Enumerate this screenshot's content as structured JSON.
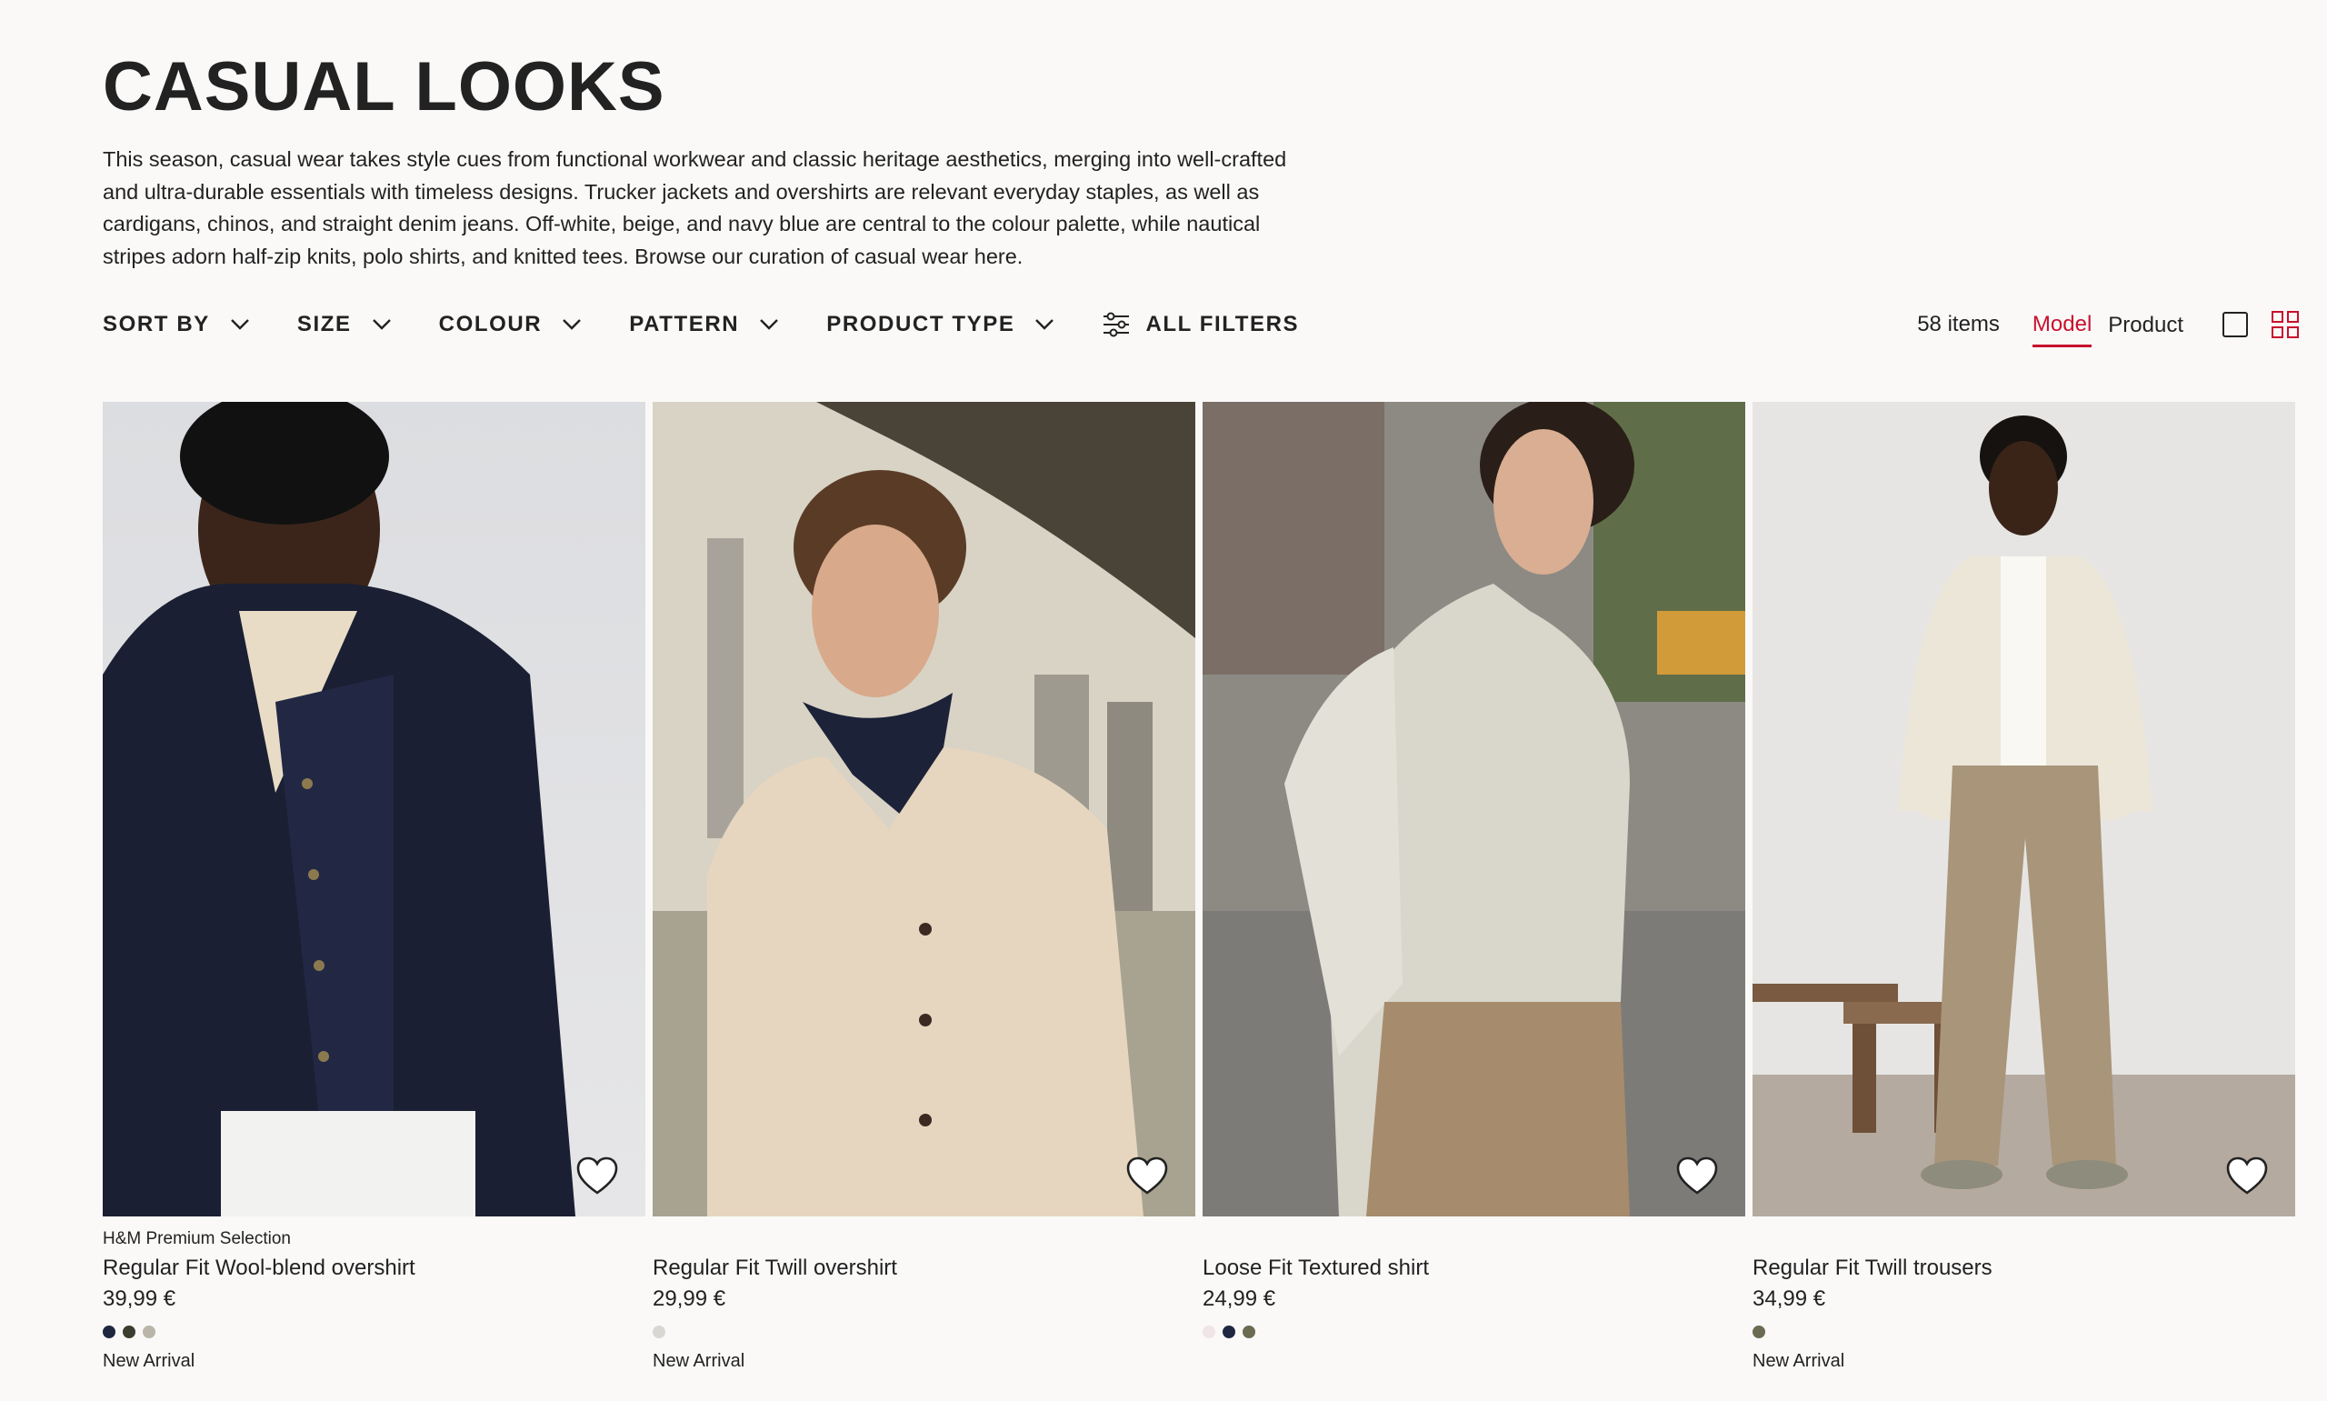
{
  "page": {
    "title": "CASUAL LOOKS",
    "description": "This season, casual wear takes style cues from functional workwear and classic heritage aesthetics, merging into well-crafted and ultra-durable essentials with timeless designs. Trucker jackets and overshirts are relevant everyday staples, as well as cardigans, chinos, and straight denim jeans. Off-white, beige, and navy blue are central to the colour palette, while nautical stripes adorn half-zip knits, polo shirts, and knitted tees. Browse our curation of casual wear here."
  },
  "filters": {
    "sort_by": "SORT BY",
    "size": "SIZE",
    "colour": "COLOUR",
    "pattern": "PATTERN",
    "product_type": "PRODUCT TYPE",
    "all_filters": "ALL FILTERS"
  },
  "view": {
    "item_count": "58 items",
    "model_label": "Model",
    "product_label": "Product",
    "active": "Model",
    "accent_color": "#c8102e"
  },
  "products": [
    {
      "brand": "H&M Premium Selection",
      "name": "Regular Fit Wool-blend overshirt",
      "price": "39,99 €",
      "swatches": [
        "#1d2740",
        "#3b3d2e",
        "#b9b5a8"
      ],
      "badge": "New Arrival",
      "image": "model wearing navy wool-blend overshirt over cream knit"
    },
    {
      "brand": "",
      "name": "Regular Fit Twill overshirt",
      "price": "29,99 €",
      "swatches": [
        "#d9d7d2"
      ],
      "badge": "New Arrival",
      "image": "model in beige twill overshirt with paisley neckerchief under bridge"
    },
    {
      "brand": "",
      "name": "Loose Fit Textured shirt",
      "price": "24,99 €",
      "swatches": [
        "#efe4e6",
        "#1d2740",
        "#6b6a52"
      ],
      "badge": "",
      "image": "model walking on city street in light textured shirt"
    },
    {
      "brand": "",
      "name": "Regular Fit Twill trousers",
      "price": "34,99 €",
      "swatches": [
        "#6b6a52"
      ],
      "badge": "New Arrival",
      "image": "model in cream overshirt and beige twill trousers by wooden bench"
    }
  ]
}
